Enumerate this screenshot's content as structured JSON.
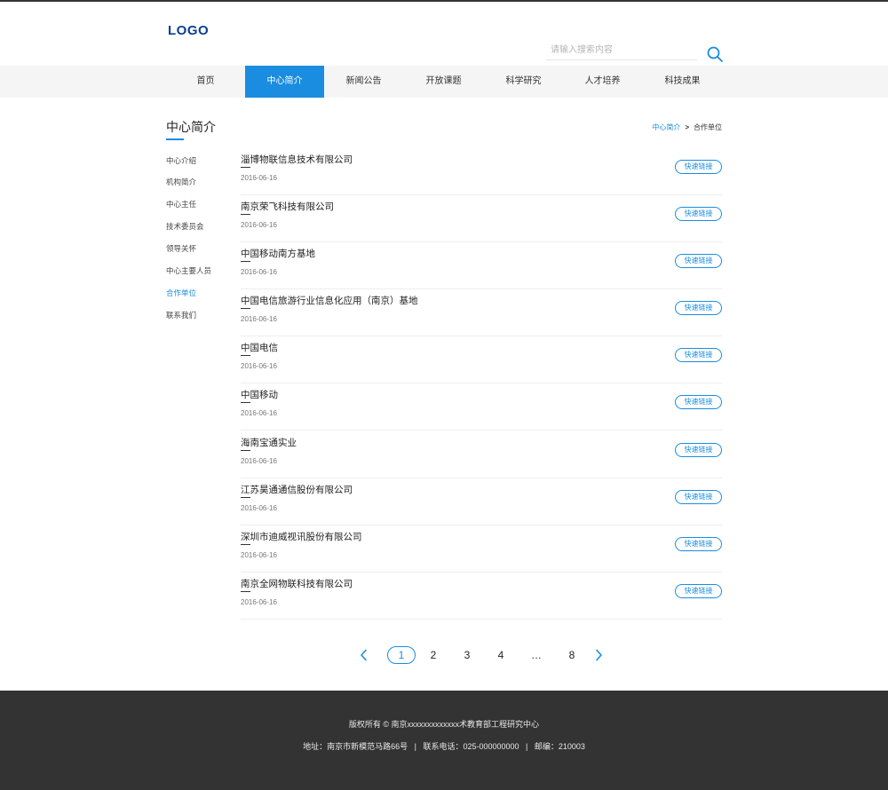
{
  "header": {
    "logo": "LOGO",
    "search_placeholder": "请输入搜索内容"
  },
  "nav": [
    {
      "label": "首页",
      "active": false
    },
    {
      "label": "中心简介",
      "active": true
    },
    {
      "label": "新闻公告",
      "active": false
    },
    {
      "label": "开放课题",
      "active": false
    },
    {
      "label": "科学研究",
      "active": false
    },
    {
      "label": "人才培养",
      "active": false
    },
    {
      "label": "科技成果",
      "active": false
    }
  ],
  "section": {
    "title": "中心简介",
    "breadcrumb": {
      "parent": "中心简介",
      "separator": ">",
      "current": "合作单位"
    }
  },
  "sidebar": [
    {
      "label": "中心介绍",
      "active": false
    },
    {
      "label": "机构简介",
      "active": false
    },
    {
      "label": "中心主任",
      "active": false
    },
    {
      "label": "技术委员会",
      "active": false
    },
    {
      "label": "领导关怀",
      "active": false
    },
    {
      "label": "中心主要人员",
      "active": false
    },
    {
      "label": "合作单位",
      "active": true
    },
    {
      "label": "联系我们",
      "active": false
    }
  ],
  "list": {
    "button_label": "快速链接",
    "items": [
      {
        "title": "淄博物联信息技术有限公司",
        "date": "2016-06-16"
      },
      {
        "title": "南京荣飞科技有限公司",
        "date": "2016-06-16"
      },
      {
        "title": "中国移动南方基地",
        "date": "2016-06-16"
      },
      {
        "title": "中国电信旅游行业信息化应用（南京）基地",
        "date": "2016-06-16"
      },
      {
        "title": "中国电信",
        "date": "2016-06-16"
      },
      {
        "title": "中国移动",
        "date": "2016-06-16"
      },
      {
        "title": "海南宝通实业",
        "date": "2016-06-16"
      },
      {
        "title": "江苏昊通通信股份有限公司",
        "date": "2016-06-16"
      },
      {
        "title": "深圳市迪威视讯股份有限公司",
        "date": "2016-06-16"
      },
      {
        "title": "南京全网物联科技有限公司",
        "date": "2016-06-16"
      }
    ]
  },
  "pagination": {
    "pages": [
      "1",
      "2",
      "3",
      "4",
      "…",
      "8"
    ],
    "current": "1"
  },
  "footer": {
    "copyright": "版权所有 © 南京xxxxxxxxxxxxx术教育部工程研究中心",
    "contact": "地址：南京市新模范马路66号   |   联系电话：025-000000000   |   邮编：210003"
  },
  "colors": {
    "accent": "#1a8de0",
    "logo": "#0b3f8f",
    "footer_bg": "#333333",
    "nav_bg": "#f5f5f5"
  },
  "icons": {
    "search": "search-icon",
    "prev": "chevron-left-icon",
    "next": "chevron-right-icon",
    "breadcrumb_separator": "chevron-right-icon"
  }
}
